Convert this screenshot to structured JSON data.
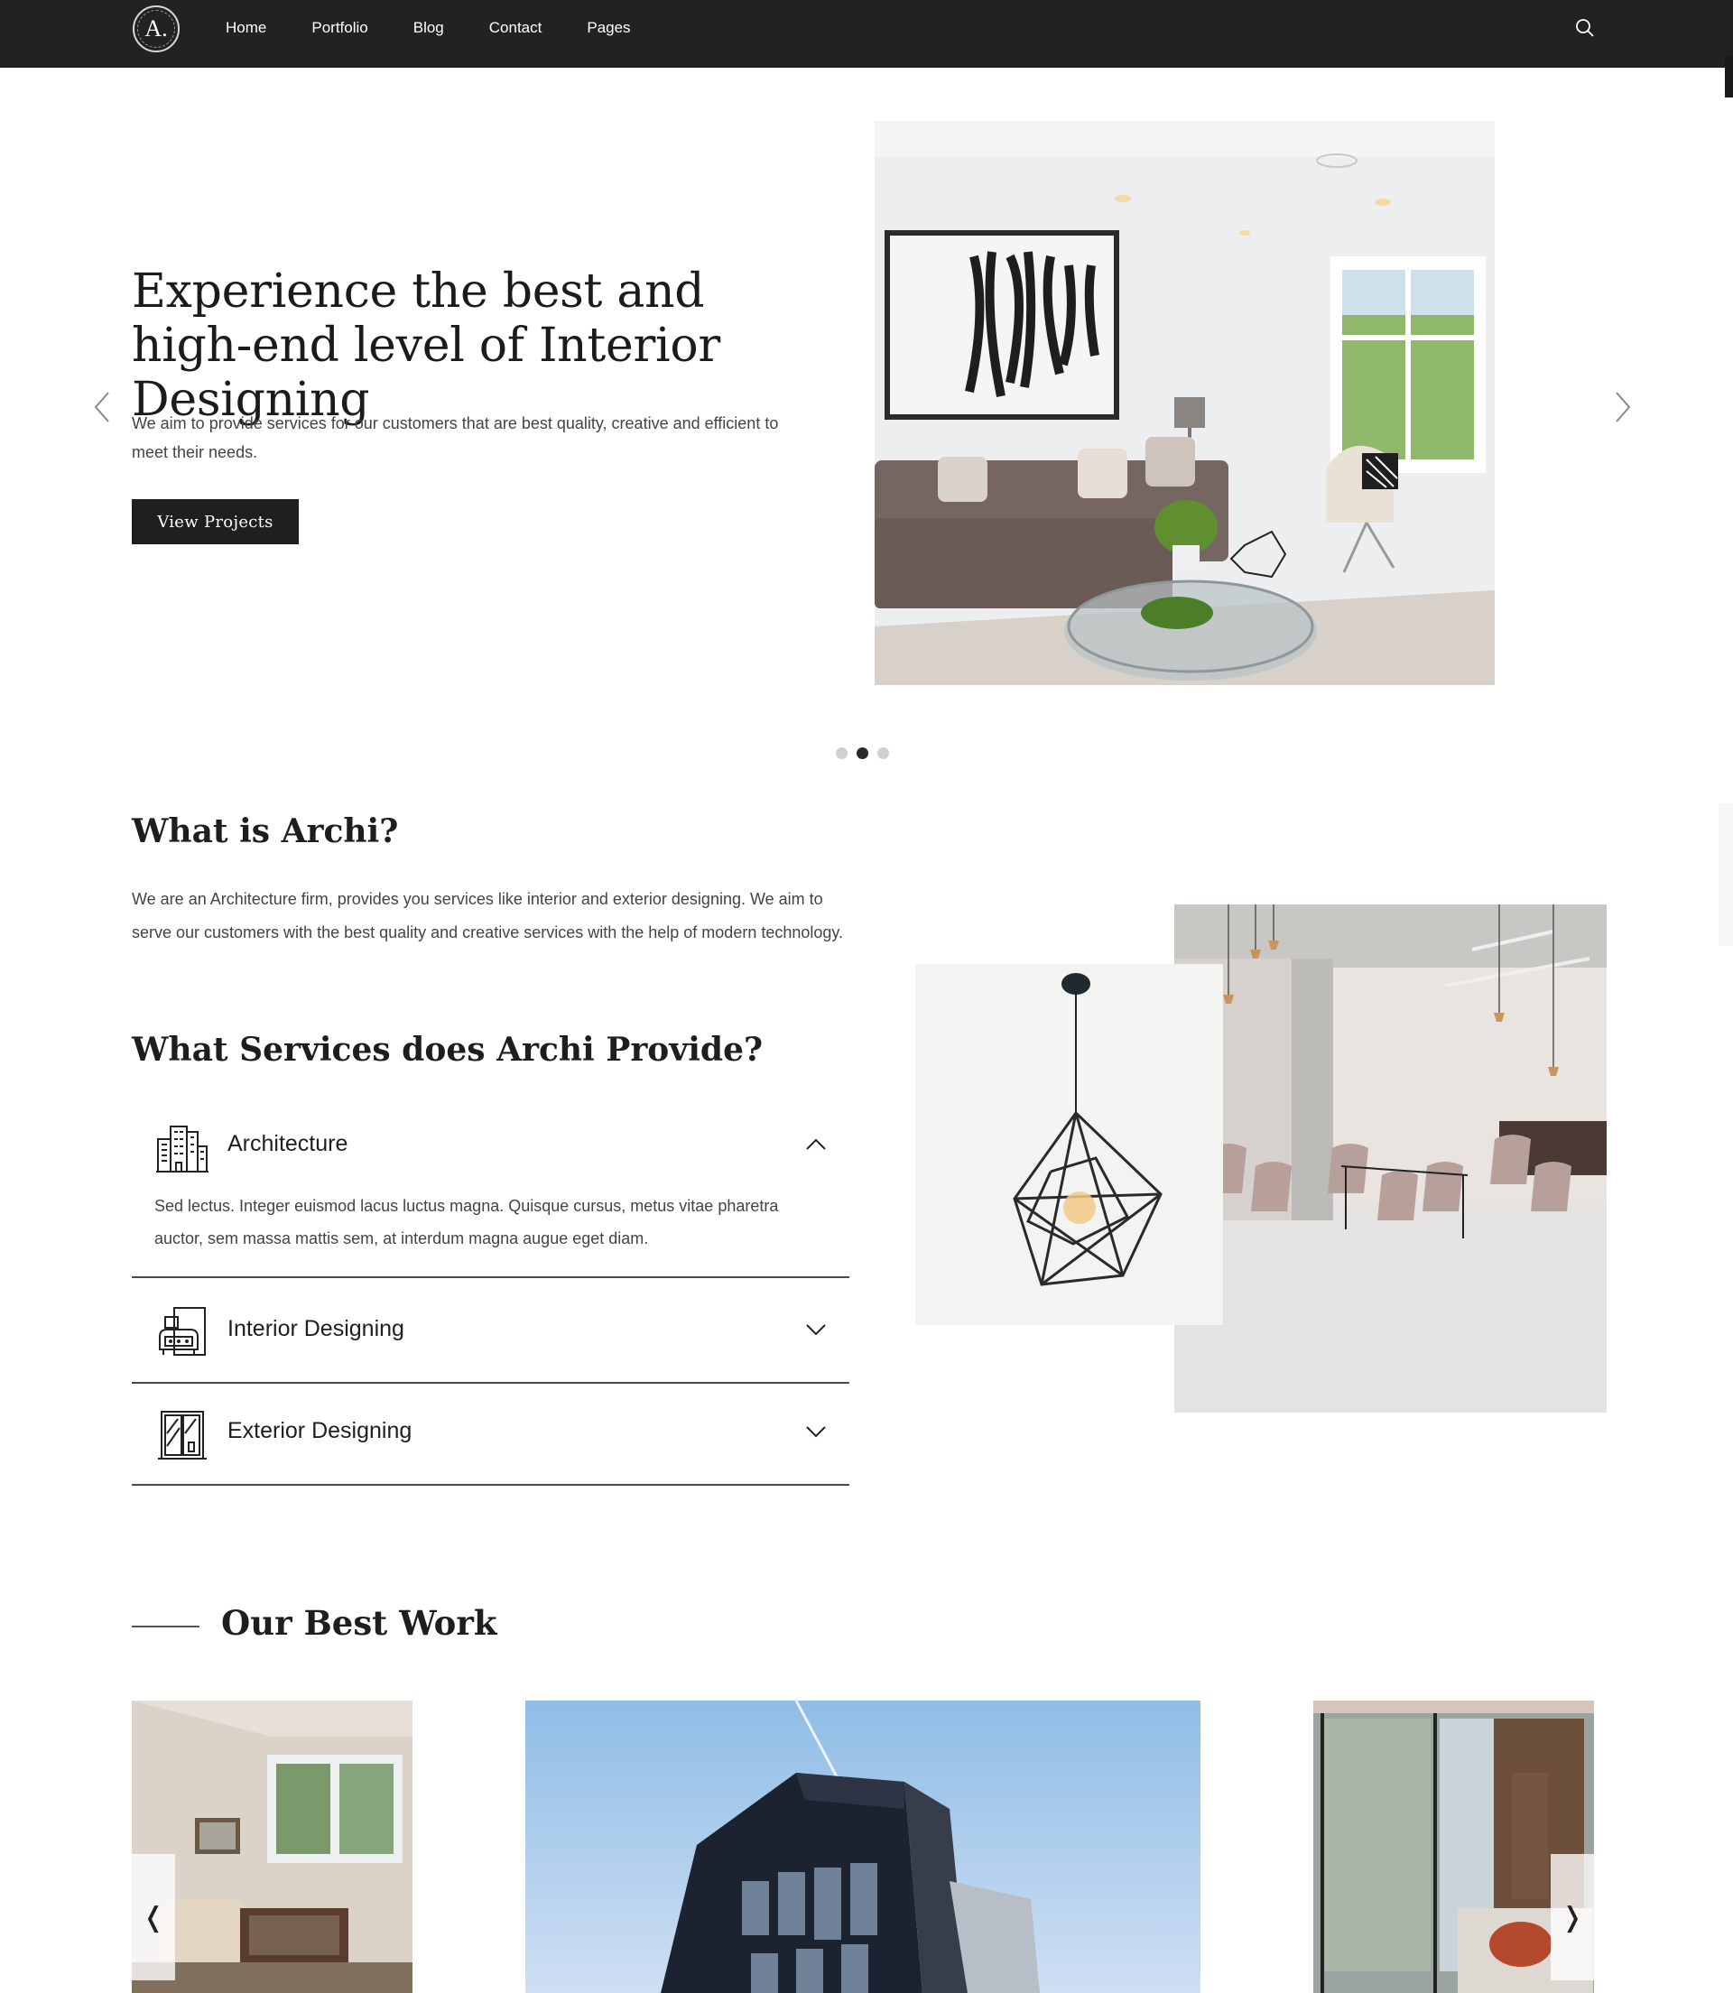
{
  "nav": {
    "logo_text": "A.",
    "items": [
      "Home",
      "Portfolio",
      "Blog",
      "Contact",
      "Pages"
    ],
    "search_icon": "search-icon"
  },
  "hero": {
    "title": "Experience the best and high-end level of Interior Designing",
    "subtitle": "We aim to provide services for our customers that are best quality, creative and efficient to meet their needs.",
    "button_label": "View Projects",
    "image": "living-room-photo",
    "active_slide": 2,
    "slide_count": 3
  },
  "about": {
    "title": "What is Archi?",
    "text": "We are an Architecture firm, provides you services like interior and exterior designing. We aim to serve our customers with the best quality and creative services with the help of modern technology."
  },
  "services": {
    "title": "What Services does Archi Provide?",
    "items": [
      {
        "label": "Architecture",
        "icon": "buildings-icon",
        "expanded": true,
        "body": "Sed lectus. Integer euismod lacus luctus magna. Quisque cursus, metus vitae pharetra auctor, sem massa mattis sem, at interdum magna augue eget diam."
      },
      {
        "label": "Interior Designing",
        "icon": "armchair-icon",
        "expanded": false
      },
      {
        "label": "Exterior Designing",
        "icon": "window-icon",
        "expanded": false
      }
    ]
  },
  "work": {
    "title": "Our Best Work",
    "prev_label": "❬",
    "next_label": "❭"
  },
  "colors": {
    "nav_bg": "#222222",
    "accent_dark": "#1f1f1f",
    "text": "#1e1e1e",
    "muted_text": "#444444"
  }
}
